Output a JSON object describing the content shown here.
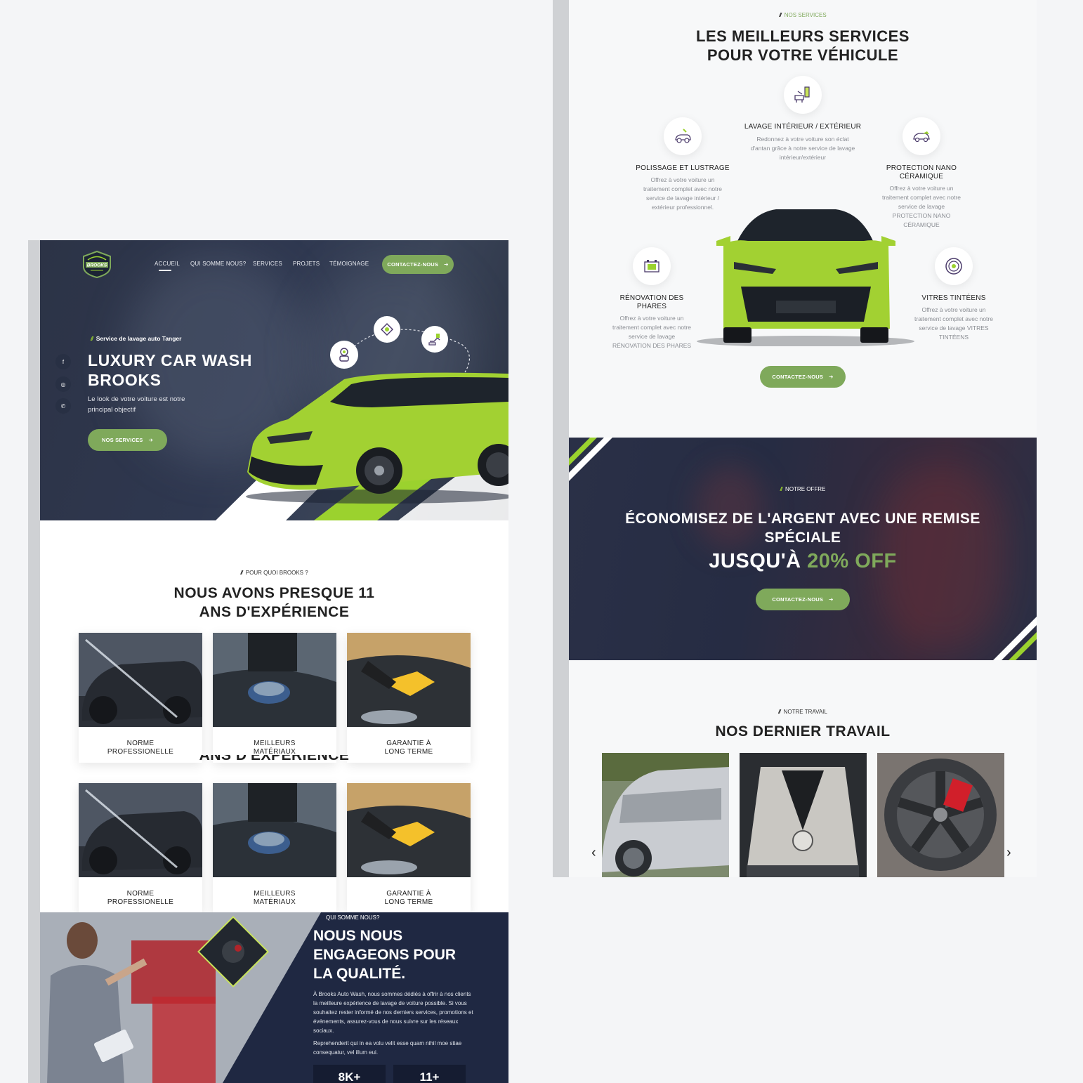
{
  "left": {
    "nav": {
      "items": [
        "ACCUEIL",
        "QUI SOMME NOUS?",
        "SERVICES",
        "PROJETS",
        "TÉMOIGNAGE"
      ],
      "cta": "CONTACTEZ-NOUS"
    },
    "hero": {
      "eyebrow": "Service de lavage auto Tanger",
      "title_line1": "LUXURY CAR WASH",
      "title_line2": "BROOKS",
      "subtitle_line1": "Le look de votre voiture est notre",
      "subtitle_line2": "principal objectif",
      "button": "NOS SERVICES",
      "socials": [
        "facebook-icon",
        "instagram-icon",
        "whatsapp-icon"
      ]
    },
    "why": {
      "eyebrow": "POUR QUOI BROOKS ?",
      "title_line1": "NOUS AVONS PRESQUE 11",
      "title_line2": "ANS D'EXPÉRIENCE",
      "ghost_title": "ANS D'EXPÉRIENCE",
      "cards": [
        {
          "line1": "NORME",
          "line2": "PROFESSIONELLE"
        },
        {
          "line1": "MEILLEURS",
          "line2": "MATÉRIAUX"
        },
        {
          "line1": "GARANTIE À",
          "line2": "LONG TERME"
        }
      ]
    },
    "about": {
      "eyebrow": "QUI SOMME NOUS?",
      "title_line1": "NOUS NOUS",
      "title_line2": "ENGAGEONS POUR",
      "title_line3": "LA QUALITÉ.",
      "p1": "À Brooks Auto Wash, nous sommes dédiés à offrir à nos clients la meilleure expérience de lavage de voiture possible. Si vous souhaitez rester informé de nos derniers services, promotions et événements, assurez-vous de nous suivre sur les réseaux sociaux.",
      "p2": "Reprehenderit qui in ea volu velit esse quam nihil moe stiae consequatur, vel illum eui.",
      "stats": [
        "8K+",
        "11+"
      ]
    }
  },
  "right": {
    "services": {
      "eyebrow": "NOS SERVICES",
      "title_line1": "LES MEILLEURS SERVICES",
      "title_line2": "POUR VOTRE VÉHICULE",
      "items": [
        {
          "icon": "car-wash-icon",
          "title": "LAVAGE INTÉRIEUR / EXTÉRIEUR",
          "desc": "Redonnez à votre voiture son éclat d'antan grâce à notre service de lavage intérieur/extérieur"
        },
        {
          "icon": "polishing-icon",
          "title": "POLISSAGE ET LUSTRAGE",
          "desc": "Offrez à votre voiture un traitement complet avec notre service de lavage intérieur / extérieur professionnel."
        },
        {
          "icon": "ceramic-car-icon",
          "title_line1": "PROTECTION NANO",
          "title_line2": "CÉRAMIQUE",
          "desc": "Offrez à votre voiture un traitement complet avec notre service de lavage PROTECTION NANO CÉRAMIQUE"
        },
        {
          "icon": "battery-icon",
          "title_line1": "RÉNOVATION DES",
          "title_line2": "PHARES",
          "desc": "Offrez à votre voiture un traitement complet avec notre service de lavage RÉNOVATION DES PHARES"
        },
        {
          "icon": "steering-wheel-icon",
          "title": "VITRES TINTÉENS",
          "desc": "Offrez à votre voiture un traitement complet avec notre service de lavage VITRES TINTÉENS"
        }
      ],
      "button": "CONTACTEZ-NOUS"
    },
    "offer": {
      "eyebrow": "NOTRE OFFRE",
      "title_line1": "ÉCONOMISEZ DE L'ARGENT AVEC UNE REMISE",
      "title_line2": "SPÉCIALE",
      "price_prefix": "JUSQU'À",
      "price_value": "20% OFF",
      "button": "CONTACTEZ-NOUS"
    },
    "work": {
      "eyebrow": "NOTRE TRAVAIL",
      "title": "NOS DERNIER TRAVAIL"
    }
  },
  "colors": {
    "accent_green": "#7fa95b",
    "lime": "#9bd22e",
    "navy": "#1f2842"
  }
}
